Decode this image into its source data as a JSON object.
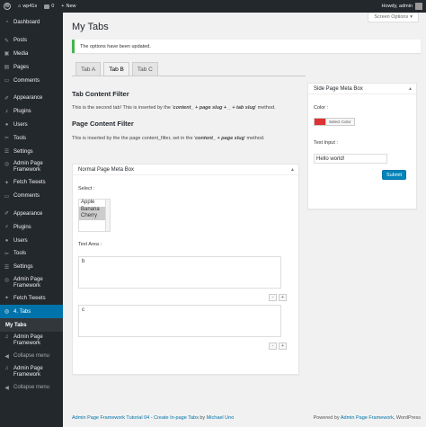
{
  "adminbar": {
    "site_name": "wp41x",
    "comments_count": "0",
    "new_label": "New",
    "howdy": "Howdy, admin"
  },
  "sidebar": {
    "dashboard": "Dashboard",
    "posts": "Posts",
    "media": "Media",
    "pages": "Pages",
    "comments": "Comments",
    "appearance": "Appearance",
    "plugins": "Plugins",
    "users": "Users",
    "tools": "Tools",
    "settings": "Settings",
    "admin_page_framework": "Admin Page Framework",
    "fetch_tweets": "Fetch Tweets",
    "comments2": "Comments",
    "appearance2": "Appearance",
    "plugins2": "Plugins",
    "users2": "Users",
    "tools2": "Tools",
    "settings2": "Settings",
    "admin_page_framework2": "Admin Page Framework",
    "fetch_tweets2": "Fetch Tweets",
    "tabs_menu": "4. Tabs",
    "my_tabs": "My Tabs",
    "admin_page_framework3": "Admin Page Framework",
    "collapse": "Collapse menu",
    "admin_page_framework4": "Admin Page Framework",
    "collapse2": "Collapse menu"
  },
  "screen_options": "Screen Options",
  "page_title": "My Tabs",
  "notice": "The options have been updated.",
  "tabs": [
    "Tab A",
    "Tab B",
    "Tab C"
  ],
  "content": {
    "tab_filter_title": "Tab Content Filter",
    "tab_filter_text_pre": "This is the second tab! This is inserted by the '",
    "tab_filter_text_em": "content_ + page slug + _ + tab slug",
    "tab_filter_text_post": "' method.",
    "page_filter_title": "Page Content Filter",
    "page_filter_text_pre": "This is inserted by the the page content_filter, set in the '",
    "page_filter_text_em": "content_ + page slug",
    "page_filter_text_post": "' method."
  },
  "normal_box": {
    "title": "Normal Page Meta Box",
    "select_label": "Select :",
    "options": [
      "Apple",
      "Banana",
      "Cherry"
    ],
    "textarea_label": "Text Area :",
    "textarea_values": [
      "b",
      "c"
    ],
    "minus": "-",
    "plus": "+"
  },
  "side_box": {
    "title": "Side Page Meta Box",
    "color_label": "Color :",
    "color_value": "#dd3333",
    "select_color": "Select Color",
    "text_label": "Text Input :",
    "text_value": "Hello world!",
    "submit": "Submit"
  },
  "footer": {
    "left_link": "Admin Page Framework Tutorial 04 - Create In-page Tabs",
    "left_by": " by ",
    "left_author": "Michael Uno",
    "right_pre": "Powered by ",
    "right_link": "Admin Page Framework",
    "right_post": ", WordPress"
  }
}
